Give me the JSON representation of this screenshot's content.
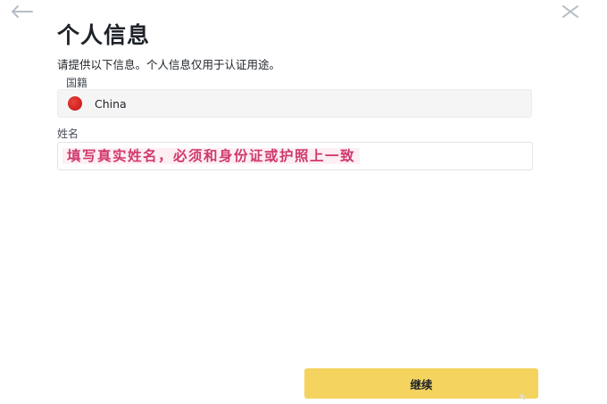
{
  "header": {
    "back_icon": "arrow-left-icon",
    "close_icon": "close-icon",
    "title": "个人信息"
  },
  "form": {
    "subtitle": "请提供以下信息。个人信息仅用于认证用途。",
    "nationality": {
      "label": "国籍",
      "value": "China",
      "flag_icon": "china-flag-icon"
    },
    "name": {
      "label": "姓名",
      "hint": "填写真实姓名，必须和身份证或护照上一致"
    }
  },
  "footer": {
    "continue_label": "继续"
  },
  "colors": {
    "primary_button": "#f5d35f",
    "hint_text": "#d0396f",
    "hint_background": "#fdeff2",
    "select_background": "#f5f5f5"
  }
}
